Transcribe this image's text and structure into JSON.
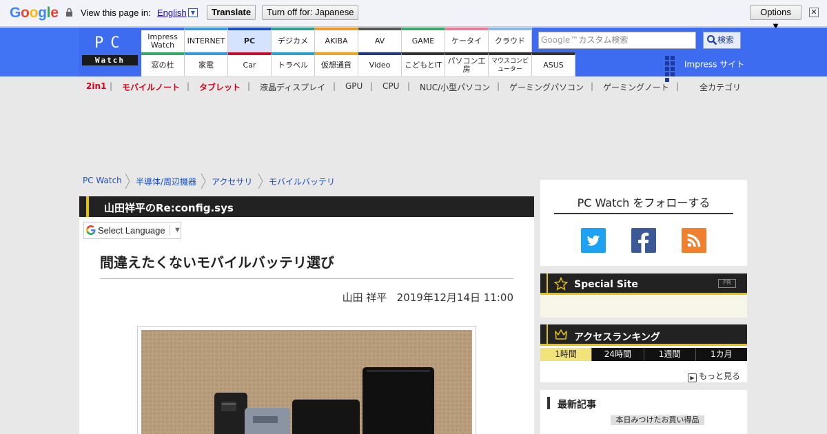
{
  "google_bar": {
    "logo": "Google",
    "view_label": "View this page in:",
    "language": "English",
    "translate_label": "Translate",
    "turn_off_label": "Turn off for: Japanese",
    "options_label": "Options ▼",
    "close_glyph": "✕"
  },
  "header": {
    "logo_top": "PC",
    "logo_bottom": "Watch",
    "nav_top": [
      "Impress Watch",
      "INTERNET",
      "PC",
      "デジカメ",
      "AKIBA",
      "AV",
      "GAME",
      "ケータイ",
      "クラウド"
    ],
    "nav_bottom": [
      "窓の杜",
      "家電",
      "Car",
      "トラベル",
      "仮想通貨",
      "Video",
      "こどもとIT",
      "パソコン工房",
      "マウスコンピューター",
      "ASUS"
    ],
    "search_google": "Google™",
    "search_placeholder": "カスタム検索",
    "search_button": "検索",
    "impress_site": "Impress サイト"
  },
  "category_bar": {
    "items": [
      "2in1",
      "モバイルノート",
      "タブレット",
      "液晶ディスプレイ",
      "GPU",
      "CPU",
      "NUC/小型パソコン",
      "ゲーミングパソコン",
      "ゲーミングノート"
    ],
    "all_label": "全カテゴリ"
  },
  "breadcrumb": [
    "PC Watch",
    "半導体/周辺機器",
    "アクセサリ",
    "モバイルバッテリ"
  ],
  "article": {
    "series": "山田祥平のRe:config.sys",
    "select_language": "Select Language",
    "title": "間違えたくないモバイルバッテリ選び",
    "author": "山田 祥平",
    "date": "2019年12月14日 11:00"
  },
  "sidebar": {
    "follow_title": "PC Watch をフォローする",
    "social": [
      "twitter-icon",
      "facebook-icon",
      "rss-icon"
    ],
    "special_title": "Special Site",
    "pr_label": "PR",
    "ranking_title": "アクセスランキング",
    "ranking_tabs": [
      "1時間",
      "24時間",
      "1週間",
      "1カ月"
    ],
    "more_label": "もっと見る",
    "latest_title": "最新記事",
    "latest_chip": "本日みつけたお買い得品"
  },
  "colors": {
    "header_blue": "#3d6cf0",
    "accent_yellow": "#e5c400",
    "category_red": "#d0021b",
    "twitter": "#1da1f2",
    "facebook": "#3b5998",
    "rss": "#ee802f"
  }
}
